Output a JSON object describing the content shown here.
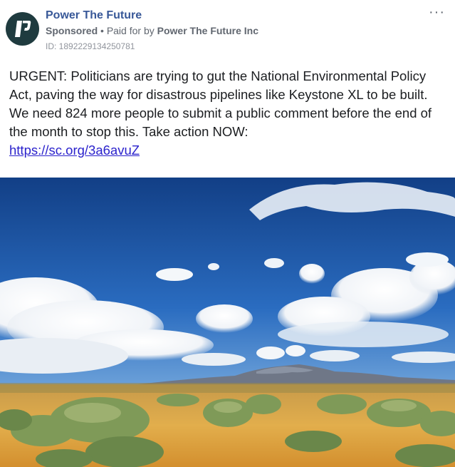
{
  "post": {
    "page_name": "Power The Future",
    "sponsored_label": "Sponsored",
    "separator": "•",
    "paid_for_prefix": "Paid for by",
    "paid_for_entity": "Power The Future Inc",
    "ad_id": "ID: 1892229134250781",
    "more_glyph": "···",
    "body_text": "URGENT: Politicians are trying to gut the National Environmental Policy Act, paving the way for disastrous pipelines like Keystone XL to be built. We need 824 more people to submit a public comment before the end of the month to stop this. Take action NOW:",
    "link_text": "https://sc.org/3a6avuZ"
  },
  "icons": {
    "avatar": "power-the-future-logo",
    "more": "more-options-icon"
  },
  "colors": {
    "page_name": "#385898",
    "link": "#2b22cc",
    "avatar_bg": "#1f3b3f",
    "sky_top": "#1b55a8",
    "desert": "#d9a64a"
  }
}
